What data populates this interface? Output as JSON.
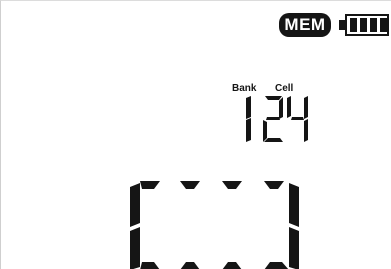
{
  "status_bar": {
    "mem_label": "MEM",
    "battery_icon": "battery-icon",
    "battery_level_bars": 4,
    "battery_total_bars": 4
  },
  "memory": {
    "bank_label": "Bank",
    "cell_label": "Cell",
    "bank_value": "1",
    "cell_value": "24"
  },
  "main_readout": {
    "display": "[---]"
  },
  "colors": {
    "segment": "#151515",
    "background": "#ffffff"
  }
}
